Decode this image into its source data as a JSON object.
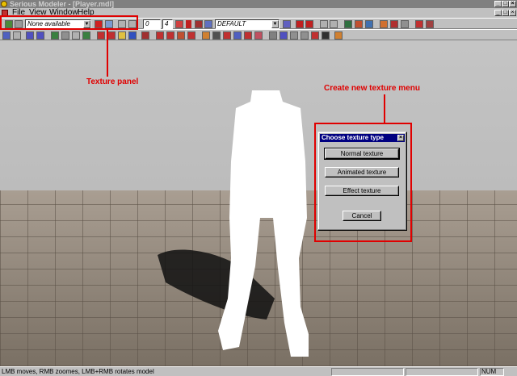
{
  "window": {
    "title": "Serious Modeler - [Player.mdl]",
    "min_label": "_",
    "max_label": "□",
    "close_label": "×"
  },
  "menubar": {
    "items": [
      "File",
      "View",
      "Window",
      "Help"
    ]
  },
  "toolbar": {
    "texture_combo_value": "None available",
    "frame_start": "0",
    "frame_end": "4",
    "animation_combo_value": "DEFAULT"
  },
  "annotations": {
    "texture_panel": "Texture panel",
    "create_texture_menu": "Create new texture menu"
  },
  "dialog": {
    "title": "Choose texture type",
    "close_label": "×",
    "buttons": [
      "Normal texture",
      "Animated texture",
      "Effect texture"
    ],
    "cancel_label": "Cancel"
  },
  "statusbar": {
    "message": "LMB moves, RMB zoomes, LMB+RMB rotates model",
    "num_indicator": "NUM"
  },
  "colors": {
    "annotation_red": "#e00000",
    "dialog_title_bg": "#000080"
  }
}
